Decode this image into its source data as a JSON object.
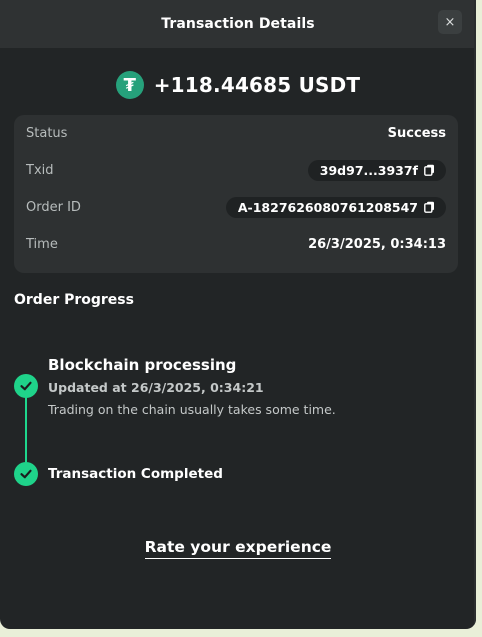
{
  "header": {
    "title": "Transaction Details",
    "close_label": "×"
  },
  "amount": {
    "text": "+118.44685 USDT",
    "coin_symbol": "₮",
    "coin_color": "#26a17b"
  },
  "details": {
    "status_label": "Status",
    "status_value": "Success",
    "txid_label": "Txid",
    "txid_value": "39d97...3937f",
    "order_id_label": "Order ID",
    "order_id_value": "A-182762608076120854​7",
    "time_label": "Time",
    "time_value": "26/3/2025, 0:34:13"
  },
  "progress": {
    "title": "Order Progress",
    "steps": [
      {
        "title": "Blockchain processing",
        "updated": "Updated at 26/3/2025, 0:34:21",
        "note": "Trading on the chain usually takes some time."
      },
      {
        "title": "Transaction Completed"
      }
    ],
    "accent": "#1fd38a"
  },
  "rate_link": "Rate your experience"
}
